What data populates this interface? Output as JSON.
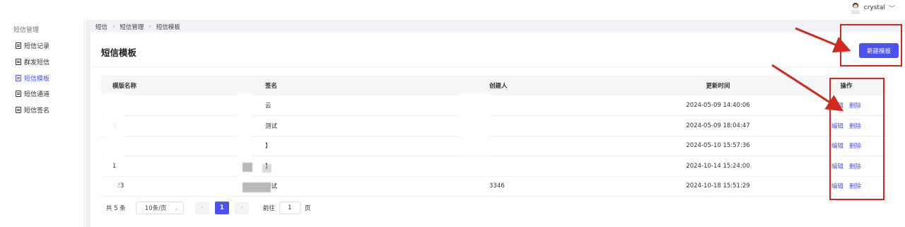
{
  "user": {
    "name": "crystal"
  },
  "sidebar": {
    "title": "短信管理",
    "items": [
      {
        "label": "短信记录",
        "active": false
      },
      {
        "label": "群发短信",
        "active": false
      },
      {
        "label": "短信模板",
        "active": true
      },
      {
        "label": "短信通道",
        "active": false
      },
      {
        "label": "短信签名",
        "active": false
      }
    ]
  },
  "breadcrumb": [
    "短信",
    "短信管理",
    "短信模板"
  ],
  "page": {
    "title": "短信模板",
    "new_button": "新建模板"
  },
  "table": {
    "columns": [
      "模版名称",
      "签名",
      "创建人",
      "更新时间",
      "操作"
    ],
    "rows": [
      {
        "name": "",
        "sign": "云",
        "creator": "",
        "updated": "2024-05-09 14:40:06"
      },
      {
        "name": "板",
        "sign": "测试",
        "creator": "",
        "updated": "2024-05-09 18:04:47"
      },
      {
        "name": "",
        "sign": "】",
        "creator": "",
        "updated": "2024-05-10 15:57:36"
      },
      {
        "name": "1",
        "sign": "】",
        "creator": "",
        "updated": "2024-10-14 15:24:00"
      },
      {
        "name": "123",
        "sign": "测试",
        "creator": "3346",
        "updated": "2024-10-18 15:51:29"
      }
    ],
    "actions": {
      "edit": "编辑",
      "delete": "删除"
    }
  },
  "pagination": {
    "total": "共 5 条",
    "page_size": "10条/页",
    "prev": "‹",
    "current": "1",
    "next": "›",
    "goto_label": "前往",
    "goto_value": "1",
    "page_unit": "页"
  },
  "colors": {
    "accent": "#4c52f0",
    "annotation": "#d02a20"
  }
}
